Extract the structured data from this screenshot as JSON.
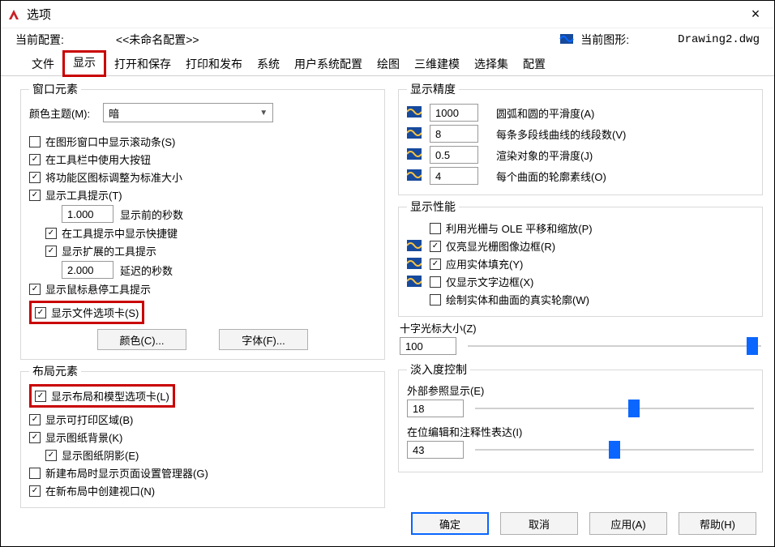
{
  "title": "选项",
  "close_icon": "×",
  "profile": {
    "label": "当前配置:",
    "name": "<<未命名配置>>"
  },
  "drawing": {
    "label": "当前图形:",
    "filename": "Drawing2.dwg"
  },
  "tabs": [
    "文件",
    "显示",
    "打开和保存",
    "打印和发布",
    "系统",
    "用户系统配置",
    "绘图",
    "三维建模",
    "选择集",
    "配置"
  ],
  "window_elements": {
    "legend": "窗口元素",
    "color_theme_label": "颜色主题(M):",
    "color_theme_value": "暗",
    "show_scrollbar": "在图形窗口中显示滚动条(S)",
    "toolbar_bigbtn": "在工具栏中使用大按钮",
    "ribbon_icon_std": "将功能区图标调整为标准大小",
    "show_tooltip": "显示工具提示(T)",
    "tooltip_delay": "1.000",
    "tooltip_delay_label": "显示前的秒数",
    "show_shortcut": "在工具提示中显示快捷键",
    "show_ext_tooltip": "显示扩展的工具提示",
    "ext_delay": "2.000",
    "ext_delay_label": "延迟的秒数",
    "show_hover": "显示鼠标悬停工具提示",
    "show_file_tabs": "显示文件选项卡(S)",
    "color_btn": "颜色(C)...",
    "font_btn": "字体(F)..."
  },
  "layout_elements": {
    "legend": "布局元素",
    "show_layout_tabs": "显示布局和模型选项卡(L)",
    "show_printable": "显示可打印区域(B)",
    "show_paper_bg": "显示图纸背景(K)",
    "show_paper_shadow": "显示图纸阴影(E)",
    "new_layout_pagesetup": "新建布局时显示页面设置管理器(G)",
    "create_viewport": "在新布局中创建视口(N)"
  },
  "precision": {
    "legend": "显示精度",
    "arc_smooth": {
      "value": "1000",
      "label": "圆弧和圆的平滑度(A)"
    },
    "polyline_seg": {
      "value": "8",
      "label": "每条多段线曲线的线段数(V)"
    },
    "render_smooth": {
      "value": "0.5",
      "label": "渲染对象的平滑度(J)"
    },
    "surface_iso": {
      "value": "4",
      "label": "每个曲面的轮廓素线(O)"
    }
  },
  "performance": {
    "legend": "显示性能",
    "raster_ole": "利用光栅与 OLE 平移和缩放(P)",
    "raster_frame": "仅亮显光栅图像边框(R)",
    "solid_fill": "应用实体填充(Y)",
    "text_frame": "仅显示文字边框(X)",
    "true_silhouette": "绘制实体和曲面的真实轮廓(W)"
  },
  "crosshair": {
    "label": "十字光标大小(Z)",
    "value": "100",
    "pos": 95
  },
  "fade": {
    "legend": "淡入度控制",
    "xref": {
      "label": "外部参照显示(E)",
      "value": "18",
      "pos": 55
    },
    "inplace": {
      "label": "在位编辑和注释性表达(I)",
      "value": "43",
      "pos": 48
    }
  },
  "buttons": {
    "ok": "确定",
    "cancel": "取消",
    "apply": "应用(A)",
    "help": "帮助(H)"
  }
}
